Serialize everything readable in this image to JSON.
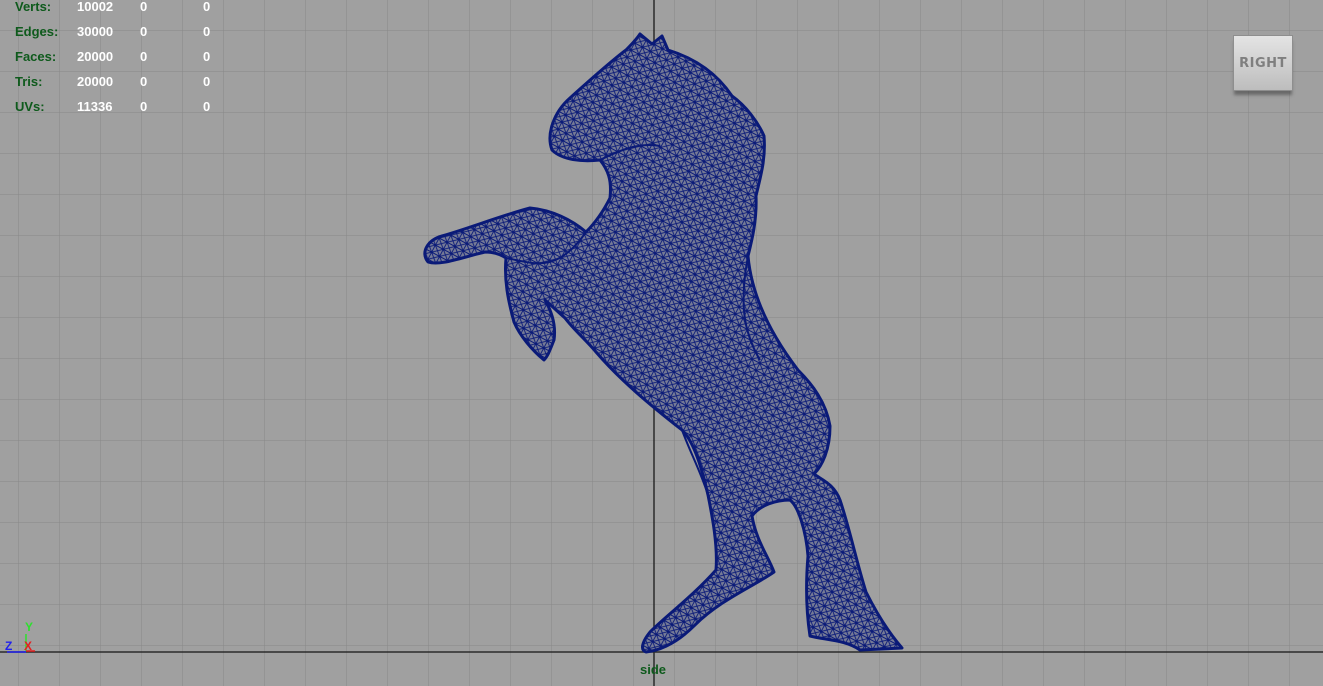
{
  "hud": {
    "rows": [
      {
        "label": "Verts:",
        "v1": "10002",
        "v2": "0",
        "v3": "0"
      },
      {
        "label": "Edges:",
        "v1": "30000",
        "v2": "0",
        "v3": "0"
      },
      {
        "label": "Faces:",
        "v1": "20000",
        "v2": "0",
        "v3": "0"
      },
      {
        "label": "Tris:",
        "v1": "20000",
        "v2": "0",
        "v3": "0"
      },
      {
        "label": "UVs:",
        "v1": "11336",
        "v2": "0",
        "v3": "0"
      }
    ]
  },
  "view_cube": {
    "label": "RIGHT"
  },
  "axis_triad": {
    "y": "Y",
    "z": "Z",
    "x": "X"
  },
  "camera": {
    "name": "side"
  },
  "colors": {
    "background": "#a0a0a0",
    "grid": "#888888",
    "axis": "#2a2a2a",
    "mesh_wire": "#0a1a78",
    "hud_label": "#0e5a1c",
    "hud_value": "#ffffff"
  },
  "icons": {
    "view_cube": "view-cube-icon",
    "axis_triad": "axis-triad-icon"
  }
}
